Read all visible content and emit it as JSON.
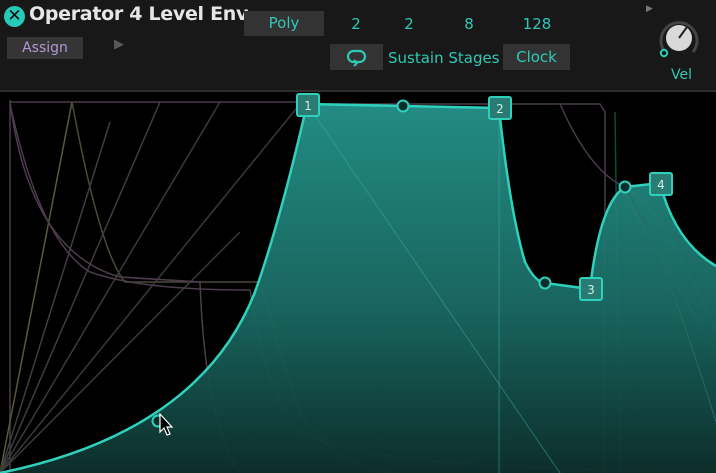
{
  "header": {
    "title": "Operator 4 Level Env",
    "assign_label": "Assign",
    "poly_label": "Poly",
    "values": [
      "2",
      "2",
      "8",
      "128"
    ],
    "sustain_stages_label": "Sustain Stages",
    "clock_label": "Clock",
    "vel_label": "Vel"
  },
  "envelope": {
    "node_labels": [
      "1",
      "2",
      "3",
      "4"
    ]
  },
  "icons": {
    "close": "close-x-icon",
    "loop": "loop-icon",
    "play": "play-arrow-icon",
    "velocity_knob": "knob-icon",
    "cursor": "mouse-pointer-icon"
  },
  "colors": {
    "accent": "#2ec9b6",
    "assign_text": "#b497d8",
    "background": "#000000",
    "header_bg": "#181818"
  }
}
